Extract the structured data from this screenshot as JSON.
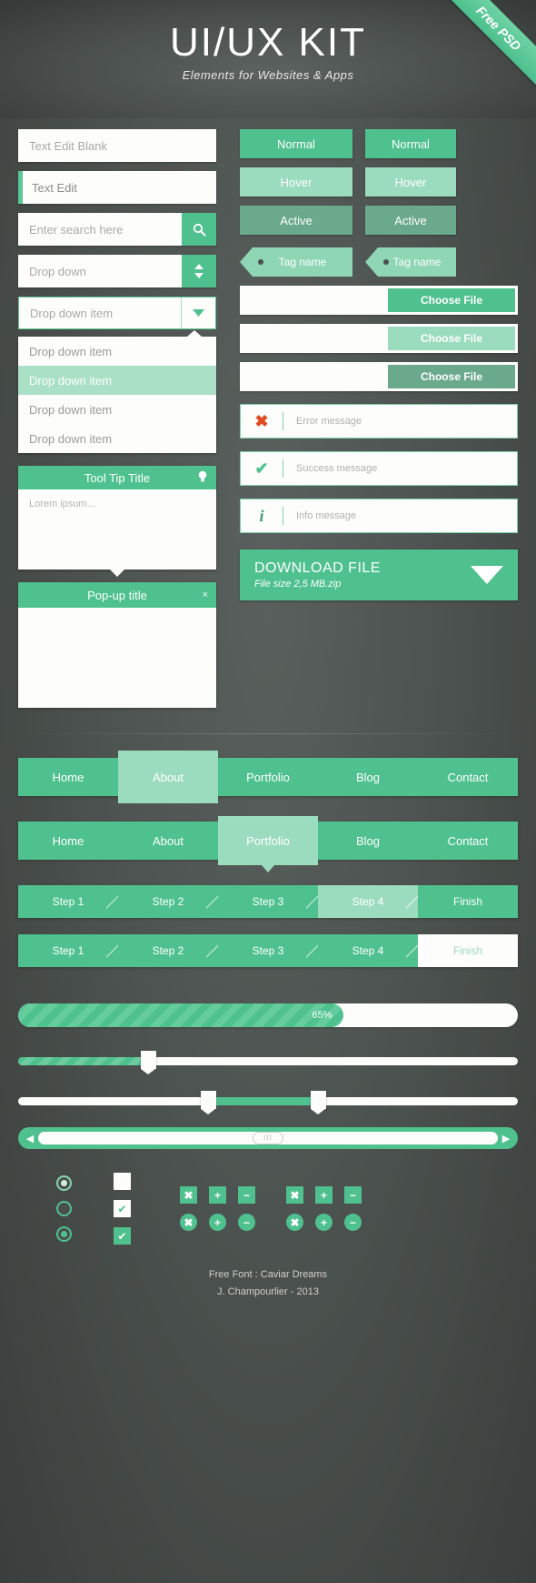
{
  "header": {
    "title": "UI/UX KIT",
    "subtitle": "Elements for Websites & Apps",
    "ribbon": "Free PSD"
  },
  "inputs": {
    "text_blank": "Text Edit Blank",
    "text_edit": "Text Edit",
    "search_placeholder": "Enter search here",
    "search_icon": "search-icon",
    "dropdown": "Drop down",
    "dropdown_item_closed": "Drop down item",
    "list_items": [
      "Drop down item",
      "Drop down item",
      "Drop down item",
      "Drop down item"
    ],
    "selected_index": 1
  },
  "tooltip": {
    "title": "Tool Tip Title",
    "icon": "lightbulb-icon",
    "body": "Lorem ipsum..."
  },
  "popup": {
    "title": "Pop-up title",
    "close": "×"
  },
  "buttons": {
    "states": [
      "Normal",
      "Hover",
      "Active"
    ]
  },
  "tags": {
    "label": "Tag name"
  },
  "file_inputs": {
    "label": "Choose File",
    "states": [
      "normal",
      "hover",
      "active"
    ]
  },
  "messages": [
    {
      "icon": "error-icon",
      "glyph": "✖",
      "text": "Error message",
      "color": "#e04a22"
    },
    {
      "icon": "success-icon",
      "glyph": "✔",
      "text": "Success message",
      "color": "#4fc18e"
    },
    {
      "icon": "info-icon",
      "glyph": "i",
      "text": "Info message",
      "color": "#3f9b73"
    }
  ],
  "download": {
    "title": "DOWNLOAD FILE",
    "subtitle": "File size 2,5 MB.zip",
    "icon": "download-arrow-icon"
  },
  "nav1": {
    "items": [
      "Home",
      "About",
      "Portfolio",
      "Blog",
      "Contact"
    ],
    "active_index": 1
  },
  "nav2": {
    "items": [
      "Home",
      "About",
      "Portfolio",
      "Blog",
      "Contact"
    ],
    "active_index": 2
  },
  "steps1": {
    "items": [
      "Step 1",
      "Step 2",
      "Step 3",
      "Step 4",
      "Finish"
    ],
    "highlight_index": 3
  },
  "steps2": {
    "items": [
      "Step 1",
      "Step 2",
      "Step 3",
      "Step 4",
      "Finish"
    ],
    "highlight_index": 4
  },
  "progress": {
    "value": "65%",
    "percent": 65
  },
  "slider_single": {
    "percent": 26
  },
  "slider_range": {
    "start_percent": 38,
    "end_percent": 60
  },
  "scrollbar": {
    "left_icon": "◀",
    "right_icon": "▶",
    "thumb_glyph": "III"
  },
  "controls": {
    "radios": [
      "radio-filled-light",
      "radio-empty",
      "radio-filled"
    ],
    "checkboxes": [
      "checkbox-empty",
      "checkbox-checked-outline",
      "checkbox-checked-filled"
    ],
    "op_rows": [
      [
        "✖",
        "+",
        "−"
      ],
      [
        "✖",
        "+",
        "−"
      ]
    ],
    "op_rows_round": [
      [
        "✖",
        "+",
        "−"
      ],
      [
        "✖",
        "+",
        "−"
      ]
    ]
  },
  "footer": {
    "line1": "Free Font : Caviar Dreams",
    "line2": "J. Champourlier - 2013"
  },
  "colors": {
    "accent": "#4fc18e",
    "accent_light": "#9cdcbe",
    "accent_dark": "#6ba98d",
    "background": "#4a4f4d",
    "error": "#e04a22"
  }
}
